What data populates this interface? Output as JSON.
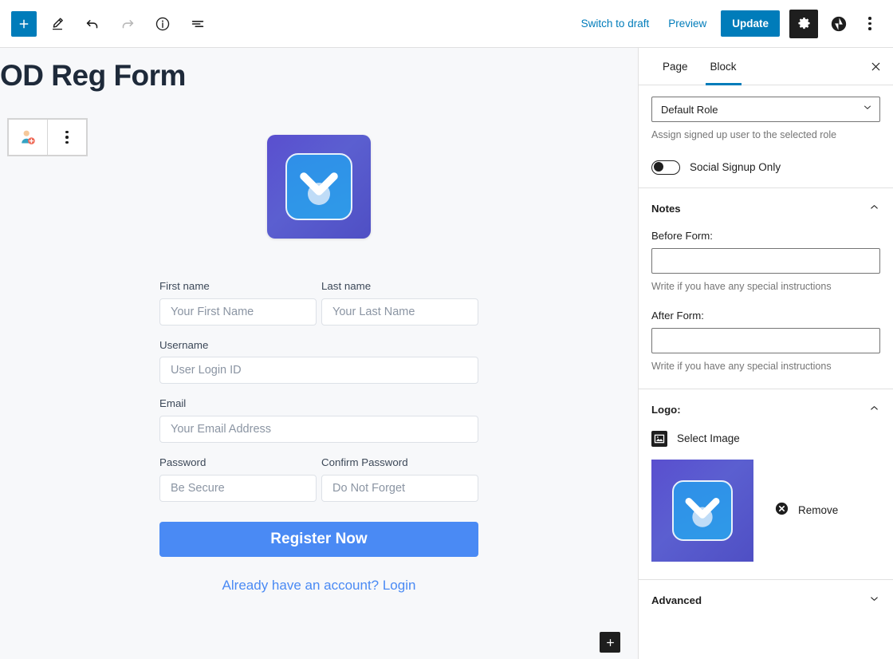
{
  "topbar": {
    "add_block_icon": "plus-icon",
    "edit_tool_icon": "pencil-icon",
    "undo_icon": "undo-arrow-icon",
    "redo_icon": "redo-arrow-icon",
    "details_icon": "info-circle-icon",
    "list_view_icon": "list-view-icon",
    "switch_to_draft_label": "Switch to draft",
    "preview_label": "Preview",
    "update_label": "Update",
    "settings_icon": "gear-icon",
    "jetpack_icon": "jetpack-icon",
    "options_icon": "vertical-ellipsis-icon",
    "update_button_color": "#007cba",
    "settings_button_color": "#1e1e1e"
  },
  "canvas": {
    "post_title": "OD Reg Form",
    "background_color": "#f7f8fa",
    "block_toolbar": {
      "block_type_icon": "user-plus-icon",
      "more_options_icon": "vertical-ellipsis-icon"
    },
    "add_block_bottom_icon": "plus-icon",
    "logo": {
      "icon": "chevron-down-logo-icon",
      "outer_gradient_start": "#5a4fcf",
      "outer_gradient_end": "#4f4fc4",
      "inner_color": "#2f9ae8"
    },
    "form": {
      "fields": [
        {
          "label": "First name",
          "placeholder": "Your First Name",
          "value": "",
          "width": "half",
          "name": "first-name"
        },
        {
          "label": "Last name",
          "placeholder": "Your Last Name",
          "value": "",
          "width": "half",
          "name": "last-name"
        },
        {
          "label": "Username",
          "placeholder": "User Login ID",
          "value": "",
          "width": "full",
          "name": "username"
        },
        {
          "label": "Email",
          "placeholder": "Your Email Address",
          "value": "",
          "width": "full",
          "name": "email"
        },
        {
          "label": "Password",
          "placeholder": "Be Secure",
          "value": "",
          "width": "half",
          "name": "password"
        },
        {
          "label": "Confirm Password",
          "placeholder": "Do Not Forget",
          "value": "",
          "width": "half",
          "name": "confirm-password"
        }
      ],
      "submit_label": "Register Now",
      "submit_color": "#4a8af4",
      "login_link_label": "Already have an account? Login",
      "login_link_color": "#4a8af4"
    }
  },
  "sidebar": {
    "tabs": [
      {
        "label": "Page",
        "active": false
      },
      {
        "label": "Block",
        "active": true
      }
    ],
    "close_icon": "close-icon",
    "accent_color": "#007cba",
    "role": {
      "selected": "Default Role",
      "options": [
        "Default Role"
      ],
      "help": "Assign signed up user to the selected role"
    },
    "social_signup": {
      "label": "Social Signup Only",
      "enabled": false
    },
    "notes_panel": {
      "title": "Notes",
      "expanded": true,
      "chevron_icon": "chevron-up-icon",
      "before_form": {
        "label": "Before Form:",
        "value": "",
        "placeholder": "",
        "help": "Write if you have any special instructions"
      },
      "after_form": {
        "label": "After Form:",
        "value": "",
        "placeholder": "",
        "help": "Write if you have any special instructions"
      }
    },
    "logo_panel": {
      "title": "Logo:",
      "expanded": true,
      "chevron_icon": "chevron-up-icon",
      "select_image_label": "Select Image",
      "select_image_icon": "image-icon",
      "remove_label": "Remove",
      "remove_icon": "close-circle-icon"
    },
    "advanced_panel": {
      "title": "Advanced",
      "expanded": false,
      "chevron_icon": "chevron-down-icon"
    }
  }
}
